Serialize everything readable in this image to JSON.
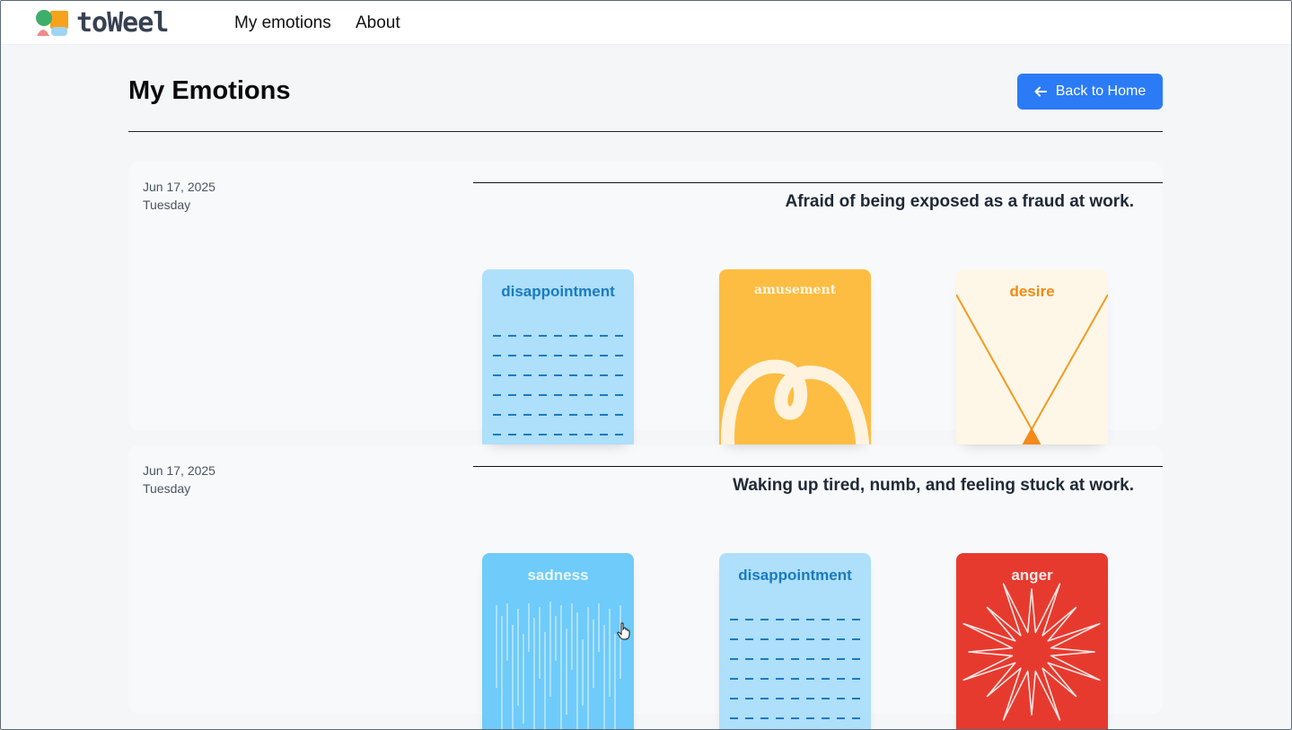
{
  "app": {
    "brand": "toWeel"
  },
  "nav": {
    "items": [
      {
        "label": "My emotions"
      },
      {
        "label": "About"
      }
    ]
  },
  "header": {
    "title": "My Emotions",
    "back_label": "Back to Home"
  },
  "entries": [
    {
      "date": "Jun 17, 2025",
      "weekday": "Tuesday",
      "text": "Afraid of being exposed as a fraud at work.",
      "cards": [
        {
          "label": "disappointment",
          "color": "#aedffb",
          "text_color": "#1a7bc0"
        },
        {
          "label": "amusement",
          "color": "#fdbd42",
          "text_color": "#fff7e6"
        },
        {
          "label": "desire",
          "color": "#fef7e8",
          "text_color": "#f28a12"
        }
      ]
    },
    {
      "date": "Jun 17, 2025",
      "weekday": "Tuesday",
      "text": "Waking up tired, numb, and feeling stuck at work.",
      "cards": [
        {
          "label": "sadness",
          "color": "#6ecbfa",
          "text_color": "#eaf7ff"
        },
        {
          "label": "disappointment",
          "color": "#aedffb",
          "text_color": "#1a7bc0"
        },
        {
          "label": "anger",
          "color": "#e73a2f",
          "text_color": "#ffeaea"
        }
      ]
    }
  ],
  "icons": {
    "back": "arrow-left-icon",
    "logo": "toweel-logo-icon",
    "cursor": "hand-pointer-icon"
  }
}
